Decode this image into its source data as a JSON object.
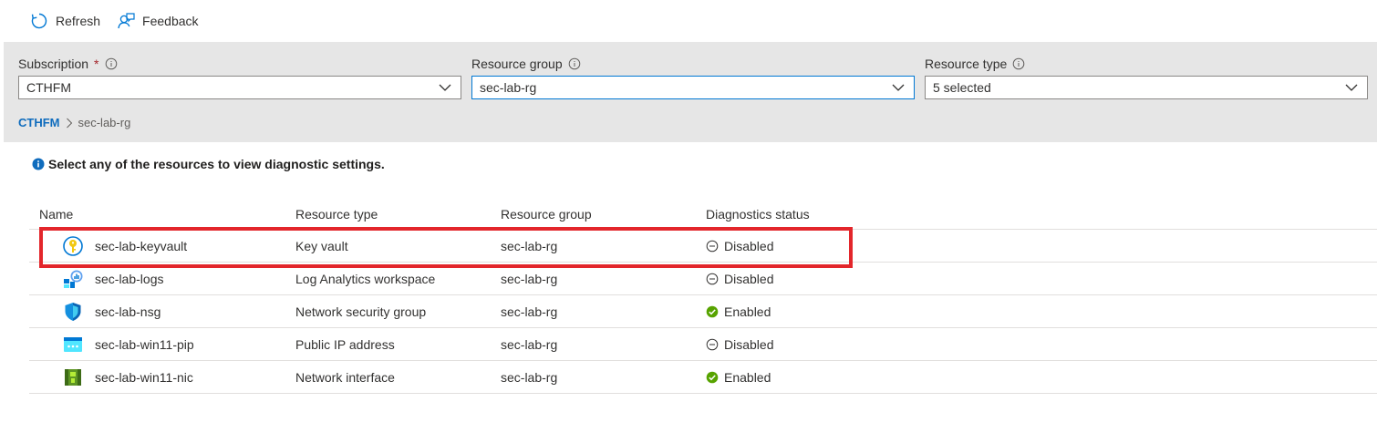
{
  "toolbar": {
    "refresh_label": "Refresh",
    "feedback_label": "Feedback"
  },
  "filters": {
    "subscription": {
      "label": "Subscription",
      "required_mark": "*",
      "value": "CTHFM"
    },
    "resource_group": {
      "label": "Resource group",
      "value": "sec-lab-rg"
    },
    "resource_type": {
      "label": "Resource type",
      "value": "5 selected"
    }
  },
  "breadcrumb": {
    "root": "CTHFM",
    "current": "sec-lab-rg"
  },
  "notice": "Select any of the resources to view diagnostic settings.",
  "table": {
    "headers": {
      "name": "Name",
      "type": "Resource type",
      "group": "Resource group",
      "status": "Diagnostics status"
    },
    "rows": [
      {
        "name": "sec-lab-keyvault",
        "type": "Key vault",
        "group": "sec-lab-rg",
        "status": "Disabled",
        "icon": "key-vault-icon"
      },
      {
        "name": "sec-lab-logs",
        "type": "Log Analytics workspace",
        "group": "sec-lab-rg",
        "status": "Disabled",
        "icon": "log-analytics-icon"
      },
      {
        "name": "sec-lab-nsg",
        "type": "Network security group",
        "group": "sec-lab-rg",
        "status": "Enabled",
        "icon": "shield-icon"
      },
      {
        "name": "sec-lab-win11-pip",
        "type": "Public IP address",
        "group": "sec-lab-rg",
        "status": "Disabled",
        "icon": "public-ip-icon"
      },
      {
        "name": "sec-lab-win11-nic",
        "type": "Network interface",
        "group": "sec-lab-rg",
        "status": "Enabled",
        "icon": "network-interface-icon"
      }
    ]
  },
  "colors": {
    "accent": "#0078d4",
    "link": "#0f6cbd",
    "enabled": "#57a300",
    "highlight": "#e3262b",
    "panel": "#e6e6e6"
  }
}
